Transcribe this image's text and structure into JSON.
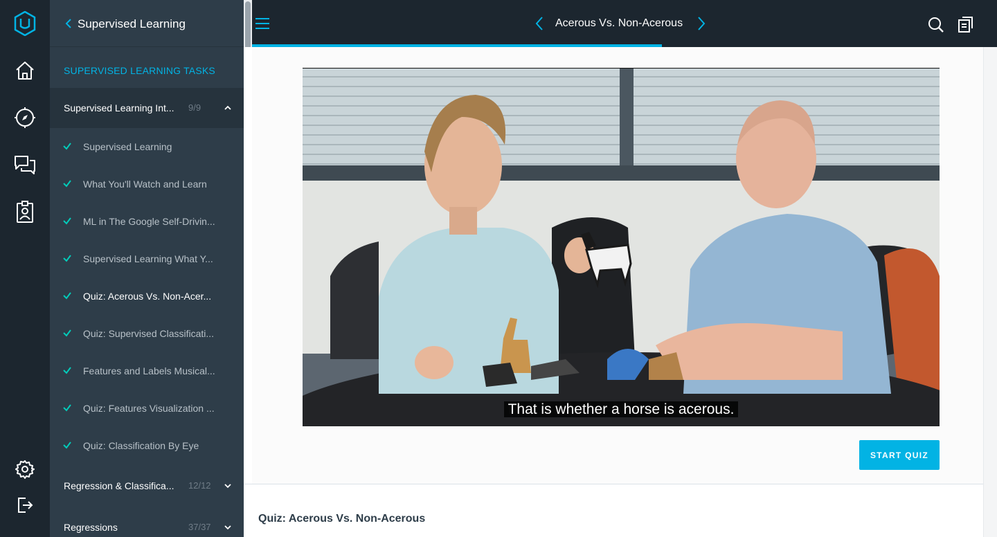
{
  "rail": {
    "items": [
      "udacity-logo",
      "home-icon",
      "compass-icon",
      "chat-icon",
      "badge-icon",
      "settings-icon",
      "logout-icon"
    ]
  },
  "sidebar": {
    "back_title": "Supervised Learning",
    "section_title": "SUPERVISED LEARNING TASKS",
    "lessons": [
      {
        "label": "Supervised Learning Int...",
        "count": "9/9",
        "expanded": true
      },
      {
        "label": "Regression & Classifica...",
        "count": "12/12",
        "expanded": false
      },
      {
        "label": "Regressions",
        "count": "37/37",
        "expanded": false
      }
    ],
    "concepts": [
      {
        "label": "Supervised Learning",
        "done": true
      },
      {
        "label": "What You'll Watch and Learn",
        "done": true
      },
      {
        "label": "ML in The Google Self-Drivin...",
        "done": true
      },
      {
        "label": "Supervised Learning What Y...",
        "done": true
      },
      {
        "label": "Quiz: Acerous Vs. Non-Acer...",
        "done": true,
        "active": true
      },
      {
        "label": "Quiz: Supervised Classificati...",
        "done": true
      },
      {
        "label": "Features and Labels Musical...",
        "done": true
      },
      {
        "label": "Quiz: Features Visualization ...",
        "done": true
      },
      {
        "label": "Quiz: Classification By Eye",
        "done": true
      }
    ]
  },
  "topbar": {
    "title": "Acerous Vs. Non-Acerous",
    "progress": 0.55
  },
  "video": {
    "caption": "That is whether a horse is acerous."
  },
  "actions": {
    "start_quiz": "START QUIZ"
  },
  "content": {
    "quiz_title": "Quiz: Acerous Vs. Non-Acerous"
  },
  "colors": {
    "accent": "#02b3e4",
    "rail_bg": "#1c262f",
    "sidebar_bg": "#2e3d49",
    "check": "#02ccba"
  }
}
